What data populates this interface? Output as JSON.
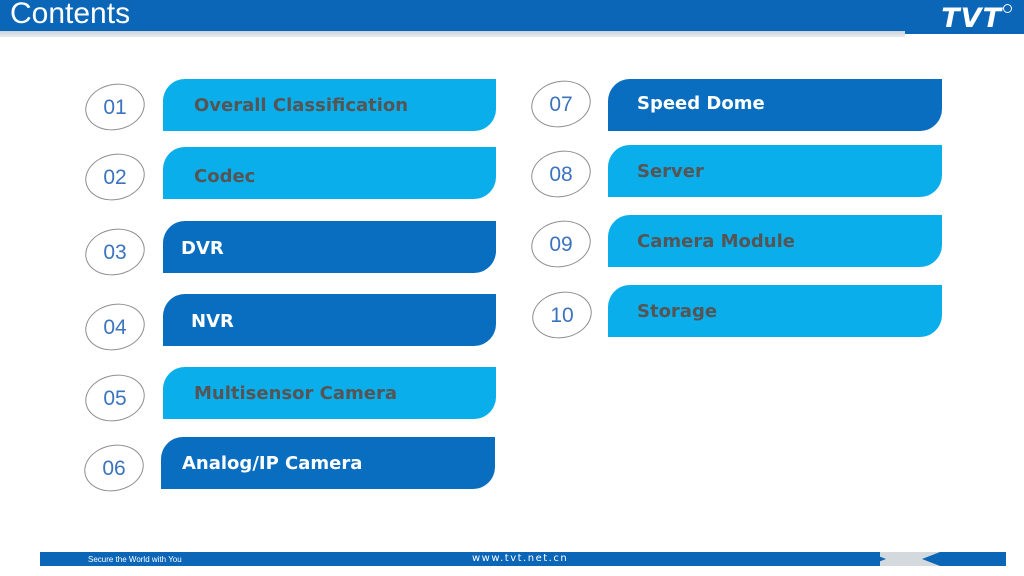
{
  "header": {
    "title": "Contents",
    "logo_text": "TVT",
    "bar_color": "#0b66b8"
  },
  "colors": {
    "light_bar": "#0aaeea",
    "dark_bar": "#0a6ec0",
    "number_text": "#3b73bf"
  },
  "items": [
    {
      "number": "01",
      "label": "Overall Classification",
      "style": "light"
    },
    {
      "number": "02",
      "label": "Codec",
      "style": "light"
    },
    {
      "number": "03",
      "label": "DVR",
      "style": "dark"
    },
    {
      "number": "04",
      "label": "NVR",
      "style": "dark"
    },
    {
      "number": "05",
      "label": "Multisensor Camera",
      "style": "light"
    },
    {
      "number": "06",
      "label": "Analog/IP Camera",
      "style": "dark"
    },
    {
      "number": "07",
      "label": "Speed Dome",
      "style": "dark"
    },
    {
      "number": "08",
      "label": "Server",
      "style": "light"
    },
    {
      "number": "09",
      "label": "Camera Module",
      "style": "light"
    },
    {
      "number": "10",
      "label": "Storage",
      "style": "light"
    }
  ],
  "footer": {
    "tagline": "Secure the World with You",
    "website": "www.tvt.net.cn"
  }
}
